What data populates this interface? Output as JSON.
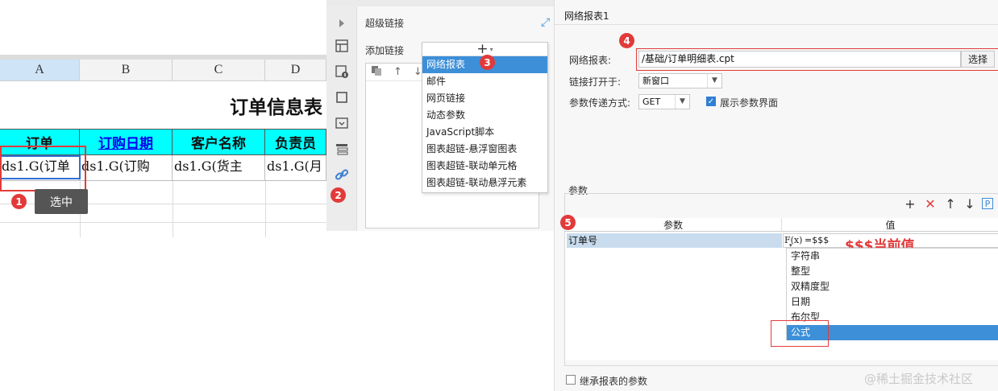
{
  "sheet": {
    "columns": [
      "A",
      "B",
      "C",
      "D"
    ],
    "title": "订单信息表",
    "headers": [
      "订单",
      "订购日期",
      "客户名称",
      "负责员"
    ],
    "cells": [
      "ds1.G(订单",
      "ds1.G(订购",
      "ds1.G(货主",
      "ds1.G(月"
    ],
    "badge": "1",
    "tooltip": "选中"
  },
  "hyperlink_panel": {
    "title": "超级链接",
    "add_label": "添加链接",
    "badge_menu": "3",
    "badge_icon": "2",
    "add_symbol": "+",
    "menu_items": [
      "网络报表",
      "邮件",
      "网页链接",
      "动态参数",
      "JavaScript脚本",
      "图表超链-悬浮窗图表",
      "图表超链-联动单元格",
      "图表超链-联动悬浮元素"
    ]
  },
  "web_report": {
    "title": "网络报表1",
    "badge_path": "4",
    "report_label": "网络报表:",
    "report_value": "/基础/订单明细表.cpt",
    "choose_button": "选择",
    "open_label": "链接打开于:",
    "open_value": "新窗口",
    "method_label": "参数传递方式:",
    "method_value": "GET",
    "show_params_label": "展示参数界面",
    "params_title": "参数",
    "badge_params": "5",
    "col_param": "参数",
    "col_value": "值",
    "param_name": "订单号",
    "fx_label": "F(x)",
    "fx_value": "=$$$",
    "annotation": "$$$当前值",
    "types": [
      "字符串",
      "整型",
      "双精度型",
      "日期",
      "布尔型",
      "公式"
    ],
    "inherit_label": "继承报表的参数",
    "watermark": "@稀土掘金技术社区",
    "tool_p": "P"
  },
  "colors": {
    "header_cyan": "#00ffff",
    "selection_blue": "#3d8fd8",
    "highlight_red": "#e33b3b"
  }
}
